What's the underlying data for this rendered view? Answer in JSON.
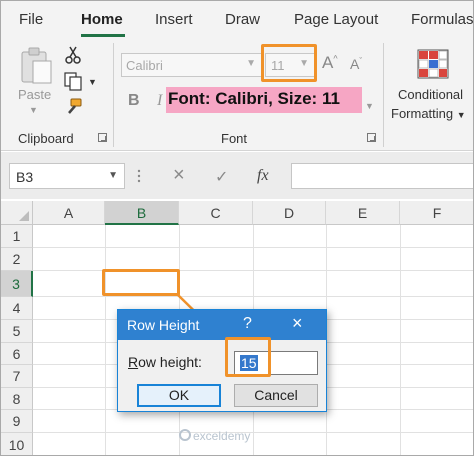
{
  "tabs": [
    {
      "label": "File"
    },
    {
      "label": "Home"
    },
    {
      "label": "Insert"
    },
    {
      "label": "Draw"
    },
    {
      "label": "Page Layout"
    },
    {
      "label": "Formulas"
    }
  ],
  "active_tab": "Home",
  "ribbon": {
    "clipboard": {
      "paste_label": "Paste",
      "group_label": "Clipboard"
    },
    "font": {
      "font_name": "Calibri",
      "font_size": "11",
      "bold": "B",
      "italic": "I",
      "grow": "A",
      "shrink": "A",
      "group_label": "Font"
    },
    "conditional_formatting": {
      "line1": "Conditional",
      "line2": "Formatting"
    }
  },
  "callout": {
    "text": "Font: Calibri, Size: 11"
  },
  "formula_bar": {
    "name_box": "B3",
    "cancel_icon": "×",
    "enter_icon": "✓",
    "fx_label": "fx",
    "formula": ""
  },
  "sheet": {
    "columns": [
      "A",
      "B",
      "C",
      "D",
      "E",
      "F"
    ],
    "rows": [
      "1",
      "2",
      "3",
      "4",
      "5",
      "6",
      "7",
      "8",
      "9",
      "10"
    ],
    "selected_cell": "B3"
  },
  "dialog": {
    "title": "Row Height",
    "help": "?",
    "close": "×",
    "label_underlined": "R",
    "label_rest": "ow height:",
    "value": "15",
    "ok": "OK",
    "cancel": "Cancel"
  },
  "watermark": {
    "text": "exceldemy"
  },
  "colors": {
    "accent": "#217346",
    "highlight_orange": "#f0922a",
    "callout_pink": "#f6a6c4",
    "dialog_blue": "#2f81d0"
  }
}
